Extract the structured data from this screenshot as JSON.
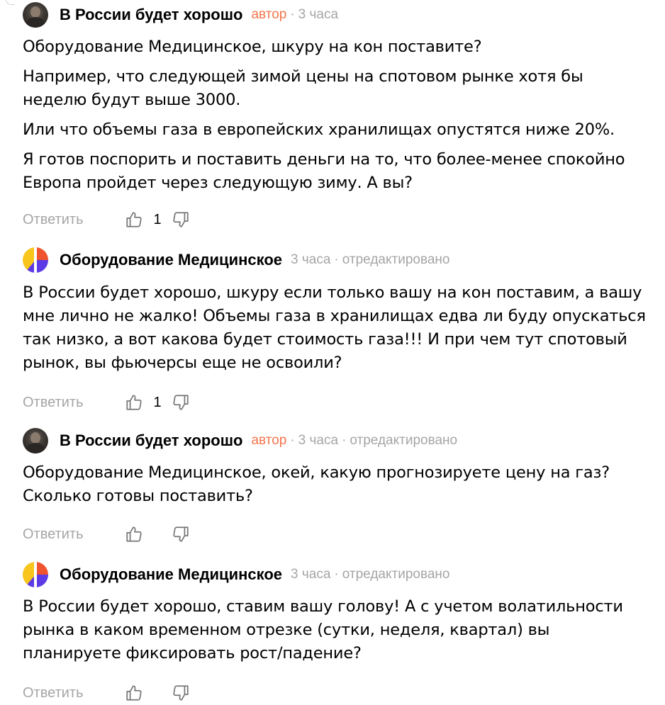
{
  "comments": [
    {
      "author": "В России будет хорошо",
      "author_tag": "автор",
      "time": "3 часа",
      "edited": "",
      "paragraphs": [
        "Оборудование Медицинское, шкуру на кон поставите?",
        "Например, что следующей зимой цены на спотовом рынке хотя бы неделю будут выше 3000.",
        "Или что объемы газа в европейских хранилищах опустятся ниже 20%.",
        "Я готов поспорить и поставить деньги на то, что более-менее спокойно Европа пройдет через следующую зиму. А вы?"
      ],
      "reply_label": "Ответить",
      "likes": "1"
    },
    {
      "author": "Оборудование Медицинское",
      "author_tag": "",
      "time": "3 часа",
      "edited": "отредактировано",
      "paragraphs": [
        "В России будет хорошо, шкуру если только вашу на кон поставим, а вашу мне лично не жалко! Объемы газа в хранилищах едва ли буду опускаться так низко, а вот какова будет стоимость газа!!! И при чем тут спотовый рынок, вы фьючерсы еще не освоили?"
      ],
      "reply_label": "Ответить",
      "likes": "1"
    },
    {
      "author": "В России будет хорошо",
      "author_tag": "автор",
      "time": "3 часа",
      "edited": "отредактировано",
      "paragraphs": [
        "Оборудование Медицинское, окей, какую прогнозируете цену на газ? Сколько готовы поставить?"
      ],
      "reply_label": "Ответить",
      "likes": ""
    },
    {
      "author": "Оборудование Медицинское",
      "author_tag": "",
      "time": "3 часа",
      "edited": "отредактировано",
      "paragraphs": [
        "В России будет хорошо, ставим вашу голову! А с учетом волатильности рынка в каком временном отрезке (сутки, неделя, квартал) вы планируете фиксировать рост/падение?"
      ],
      "reply_label": "Ответить",
      "likes": ""
    }
  ],
  "colors": {
    "author_tag": "#f4754b",
    "meta": "#a5a5a5",
    "text": "#000000"
  },
  "icons": {
    "like": "thumbs-up-icon",
    "dislike": "thumbs-down-icon"
  }
}
